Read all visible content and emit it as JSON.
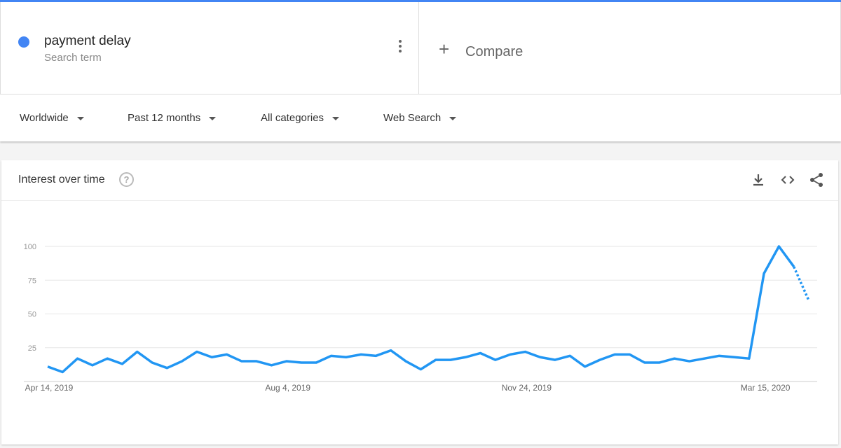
{
  "term": {
    "name": "payment delay",
    "subtitle": "Search term",
    "color": "#4285f4"
  },
  "compare": {
    "label": "Compare",
    "icon": "plus-icon"
  },
  "filters": [
    {
      "label": "Worldwide"
    },
    {
      "label": "Past 12 months"
    },
    {
      "label": "All categories"
    },
    {
      "label": "Web Search"
    }
  ],
  "card": {
    "title": "Interest over time",
    "icons": [
      "help-icon",
      "download-icon",
      "embed-icon",
      "share-icon"
    ]
  },
  "chart_data": {
    "type": "line",
    "title": "",
    "xlabel": "",
    "ylabel": "",
    "ylim": [
      0,
      100
    ],
    "yticks": [
      25,
      50,
      75,
      100
    ],
    "xtick_labels": [
      {
        "label": "Apr 14, 2019",
        "index": 0
      },
      {
        "label": "Aug 4, 2019",
        "index": 16
      },
      {
        "label": "Nov 24, 2019",
        "index": 32
      },
      {
        "label": "Mar 15, 2020",
        "index": 48
      }
    ],
    "grid": true,
    "line_color": "#2196f3",
    "x_start": "2019-04-14",
    "x_interval": "weekly",
    "partial_last_point": true,
    "values": [
      11,
      7,
      17,
      12,
      17,
      13,
      22,
      14,
      10,
      15,
      22,
      18,
      20,
      15,
      15,
      12,
      15,
      14,
      14,
      19,
      18,
      20,
      19,
      23,
      15,
      9,
      16,
      16,
      18,
      21,
      16,
      20,
      22,
      18,
      16,
      19,
      11,
      16,
      20,
      20,
      14,
      14,
      17,
      15,
      17,
      19,
      18,
      17,
      80,
      100,
      85,
      60
    ]
  }
}
